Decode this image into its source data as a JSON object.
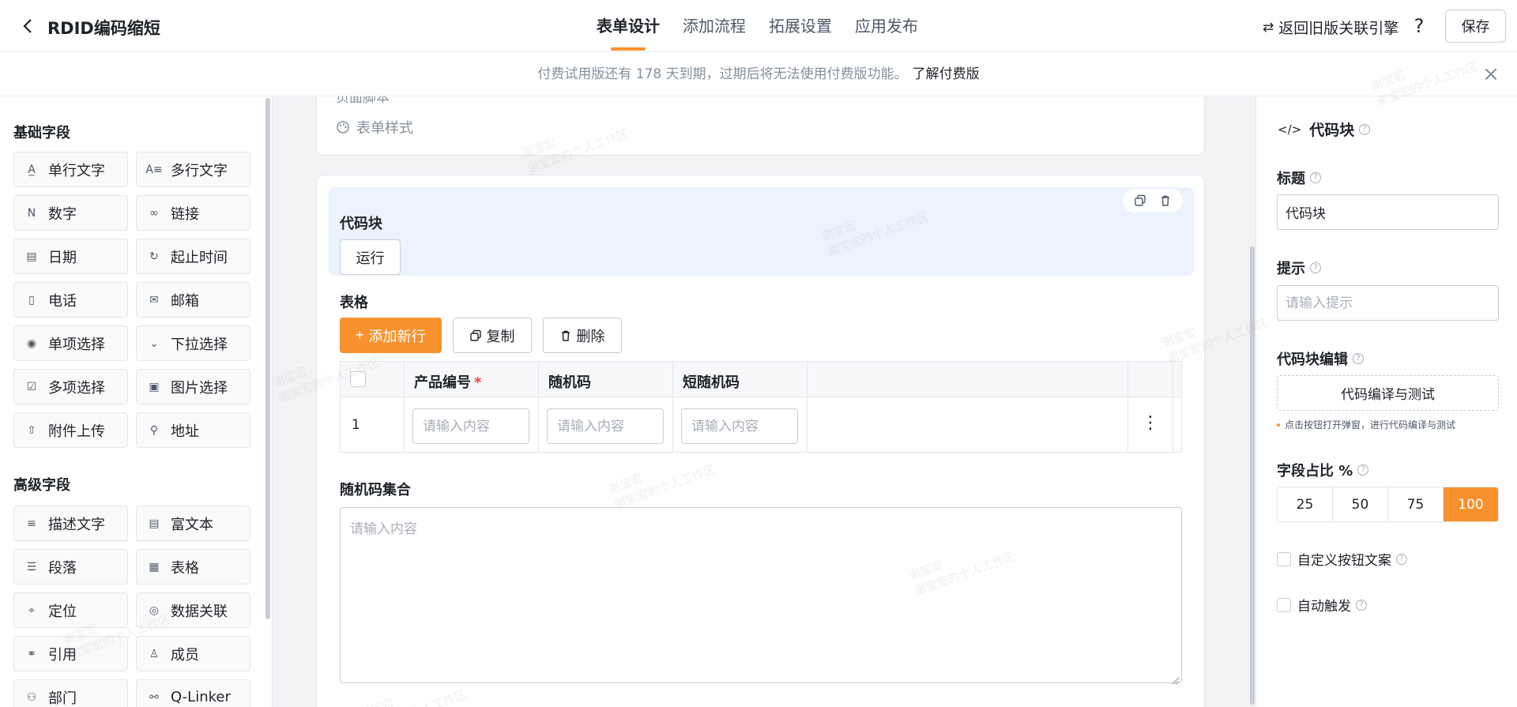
{
  "header": {
    "title": "RDID编码缩短",
    "tabs": [
      {
        "label": "表单设计",
        "active": true
      },
      {
        "label": "添加流程",
        "active": false
      },
      {
        "label": "拓展设置",
        "active": false
      },
      {
        "label": "应用发布",
        "active": false
      }
    ],
    "legacy_label": "返回旧版关联引擎",
    "help_label": "?",
    "save_label": "保存"
  },
  "notice": {
    "text": "付费试用版还有 178 天到期，过期后将无法使用付费版功能。",
    "link": "了解付费版",
    "close": "×"
  },
  "left_panel": {
    "basic_title": "基础字段",
    "basic_fields": [
      {
        "label": "单行文字",
        "icon": "single-line-text-icon",
        "glyph": "A̲"
      },
      {
        "label": "多行文字",
        "icon": "multi-line-text-icon",
        "glyph": "A≡"
      },
      {
        "label": "数字",
        "icon": "number-icon",
        "glyph": "N"
      },
      {
        "label": "链接",
        "icon": "link-icon",
        "glyph": "∞"
      },
      {
        "label": "日期",
        "icon": "calendar-icon",
        "glyph": "▤"
      },
      {
        "label": "起止时间",
        "icon": "time-range-icon",
        "glyph": "↻"
      },
      {
        "label": "电话",
        "icon": "phone-icon",
        "glyph": "▯"
      },
      {
        "label": "邮箱",
        "icon": "mail-icon",
        "glyph": "✉"
      },
      {
        "label": "单项选择",
        "icon": "radio-icon",
        "glyph": "◉"
      },
      {
        "label": "下拉选择",
        "icon": "dropdown-icon",
        "glyph": "⌄"
      },
      {
        "label": "多项选择",
        "icon": "checkbox-icon",
        "glyph": "☑"
      },
      {
        "label": "图片选择",
        "icon": "image-icon",
        "glyph": "▣"
      },
      {
        "label": "附件上传",
        "icon": "upload-icon",
        "glyph": "⇧"
      },
      {
        "label": "地址",
        "icon": "address-icon",
        "glyph": "⚲"
      }
    ],
    "advanced_title": "高级字段",
    "advanced_fields": [
      {
        "label": "描述文字",
        "icon": "description-icon",
        "glyph": "≡"
      },
      {
        "label": "富文本",
        "icon": "rich-text-icon",
        "glyph": "▤"
      },
      {
        "label": "段落",
        "icon": "paragraph-icon",
        "glyph": "☰"
      },
      {
        "label": "表格",
        "icon": "table-icon",
        "glyph": "▦"
      },
      {
        "label": "定位",
        "icon": "location-icon",
        "glyph": "⌖"
      },
      {
        "label": "数据关联",
        "icon": "data-link-icon",
        "glyph": "◎"
      },
      {
        "label": "引用",
        "icon": "reference-icon",
        "glyph": "⚭"
      },
      {
        "label": "成员",
        "icon": "member-icon",
        "glyph": "♙"
      },
      {
        "label": "部门",
        "icon": "department-icon",
        "glyph": "⚇"
      },
      {
        "label": "Q-Linker",
        "icon": "q-linker-icon",
        "glyph": "⚯"
      }
    ]
  },
  "canvas": {
    "clipped_text": "页面脚本",
    "form_style_label": "表单样式",
    "code_block": {
      "label": "代码块",
      "run_label": "运行"
    },
    "table": {
      "label": "表格",
      "add_row": "添加新行",
      "copy": "复制",
      "delete": "删除",
      "columns": [
        {
          "label": "产品编号",
          "required": "*"
        },
        {
          "label": "随机码",
          "required": ""
        },
        {
          "label": "短随机码",
          "required": ""
        }
      ],
      "rows": [
        {
          "index": "1",
          "placeholder": "请输入内容"
        }
      ]
    },
    "random_set": {
      "label": "随机码集合",
      "placeholder": "请输入内容"
    }
  },
  "right_panel": {
    "title": "代码块",
    "title_label": "标题",
    "title_value": "代码块",
    "hint_label": "提示",
    "hint_placeholder": "请输入提示",
    "code_edit_label": "代码块编辑",
    "code_edit_button": "代码编译与测试",
    "code_edit_hint": "点击按钮打开弹窗，进行代码编译与测试",
    "ratio_label": "字段占比 %",
    "ratio_options": [
      "25",
      "50",
      "75",
      "100"
    ],
    "ratio_selected": "100",
    "custom_button_text": "自定义按钮文案",
    "auto_trigger": "自动触发"
  },
  "watermark": {
    "text1": "谢宝宏",
    "text2": "谢宝宏的个人工作区"
  },
  "colors": {
    "accent": "#f7922e",
    "selected_block": "#ecf2fe"
  }
}
